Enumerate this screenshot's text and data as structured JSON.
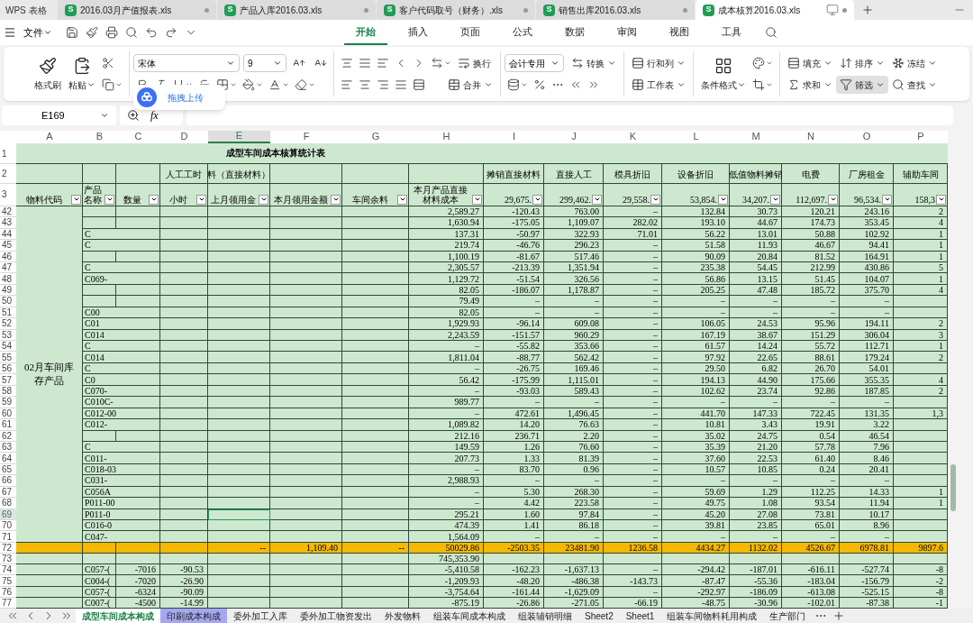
{
  "app_name": "WPS 表格",
  "file_tabs": [
    {
      "icon_letter": "S",
      "title": "2016.03月产值报表.xls",
      "selected": false
    },
    {
      "icon_letter": "S",
      "title": "产品入库2016.03.xls",
      "selected": false
    },
    {
      "icon_letter": "S",
      "title": "客户代码取号（财务）.xls",
      "selected": false
    },
    {
      "icon_letter": "S",
      "title": "销售出库2016.03.xls",
      "selected": false
    },
    {
      "icon_letter": "S",
      "title": "成本核算2016.03.xls",
      "selected": true
    }
  ],
  "file_menu": "文件",
  "ribbon_tabs": [
    {
      "label": "开始",
      "selected": true
    },
    {
      "label": "插入",
      "selected": false
    },
    {
      "label": "页面",
      "selected": false
    },
    {
      "label": "公式",
      "selected": false
    },
    {
      "label": "数据",
      "selected": false
    },
    {
      "label": "审阅",
      "selected": false
    },
    {
      "label": "视图",
      "selected": false
    },
    {
      "label": "工具",
      "selected": false
    }
  ],
  "ribbon": {
    "format_painter": "格式刷",
    "paste": "粘贴",
    "font_name": "宋体",
    "font_size": "9",
    "wrap": "换行",
    "merge": "合并",
    "number_format": "会计专用",
    "convert": "转换",
    "rows_cols": "行和列",
    "worksheet": "工作表",
    "conditional_format": "条件格式",
    "fill": "填充",
    "sort": "排序",
    "freeze": "冻结",
    "sum": "求和",
    "filter": "筛选",
    "filter_active": true,
    "find": "查找"
  },
  "upload_popup": "拖拽上传",
  "formula_bar": {
    "cell_ref": "E169",
    "fx_label": "fx"
  },
  "columns": [
    {
      "letter": "A",
      "selected": false
    },
    {
      "letter": "B",
      "selected": false
    },
    {
      "letter": "C",
      "selected": false
    },
    {
      "letter": "D",
      "selected": false
    },
    {
      "letter": "E",
      "selected": true
    },
    {
      "letter": "F",
      "selected": false
    },
    {
      "letter": "G",
      "selected": false
    },
    {
      "letter": "H",
      "selected": false
    },
    {
      "letter": "I",
      "selected": false
    },
    {
      "letter": "J",
      "selected": false
    },
    {
      "letter": "K",
      "selected": false
    },
    {
      "letter": "L",
      "selected": false
    },
    {
      "letter": "M",
      "selected": false
    },
    {
      "letter": "N",
      "selected": false
    },
    {
      "letter": "O",
      "selected": false
    },
    {
      "letter": "P",
      "selected": false
    }
  ],
  "sheet_title": {
    "row": "1",
    "text": "成型车间成本核算统计表"
  },
  "header_row2": {
    "row": "2",
    "D": "人工工时",
    "E": "料（直接材料）",
    "I": "摊销直接材料",
    "J": "直接人工",
    "K": "模具折旧",
    "L": "设备折旧",
    "M": "低值物料摊销",
    "N": "电费",
    "O": "厂房租金",
    "P": "辅助车间"
  },
  "header_row3": {
    "row": "3",
    "A": "物料代码",
    "B": "产品名称",
    "C": "数量",
    "D": "小时",
    "E": "上月领用金",
    "F": "本月领用金额",
    "G": "车间余料",
    "H": "本月产品直接材料成本",
    "I": "29,675.",
    "J": "299,462.",
    "K": "29,558.",
    "L": "53,854.",
    "M": "34,207.",
    "N": "112,697.",
    "O": "96,534.",
    "P": "158,3"
  },
  "merged_a_cell": "02月车间库存产品",
  "rows": [
    {
      "num": "42",
      "selected": false,
      "cells": {
        "H": "2,589.27",
        "I": "-120.43",
        "J": "763.00",
        "K": "–",
        "L": "132.84",
        "M": "30.73",
        "N": "120.21",
        "O": "243.16",
        "P": "2"
      }
    },
    {
      "num": "43",
      "selected": false,
      "cells": {
        "H": "1,630.94",
        "I": "-175.05",
        "J": "1,109.07",
        "K": "282.02",
        "L": "193.10",
        "M": "44.67",
        "N": "174.73",
        "O": "353.45",
        "P": "4"
      }
    },
    {
      "num": "44",
      "selected": false,
      "cells": {
        "B": "C",
        "H": "137.31",
        "I": "-50.97",
        "J": "322.93",
        "K": "71.01",
        "L": "56.22",
        "M": "13.01",
        "N": "50.88",
        "O": "102.92",
        "P": "1"
      }
    },
    {
      "num": "45",
      "selected": false,
      "cells": {
        "B": "C",
        "H": "219.74",
        "I": "-46.76",
        "J": "296.23",
        "K": "–",
        "L": "51.58",
        "M": "11.93",
        "N": "46.67",
        "O": "94.41",
        "P": "1"
      }
    },
    {
      "num": "46",
      "selected": false,
      "cells": {
        "H": "1,100.19",
        "I": "-81.67",
        "J": "517.46",
        "K": "–",
        "L": "90.09",
        "M": "20.84",
        "N": "81.52",
        "O": "164.91",
        "P": "1"
      }
    },
    {
      "num": "47",
      "selected": false,
      "cells": {
        "B": "C",
        "H": "2,305.57",
        "I": "-213.39",
        "J": "1,351.94",
        "K": "–",
        "L": "235.38",
        "M": "54.45",
        "N": "212.99",
        "O": "430.86",
        "P": "5"
      }
    },
    {
      "num": "48",
      "selected": false,
      "cells": {
        "B": "C069-",
        "H": "1,129.72",
        "I": "-51.54",
        "J": "326.56",
        "K": "–",
        "L": "56.86",
        "M": "13.15",
        "N": "51.45",
        "O": "104.07",
        "P": "1"
      }
    },
    {
      "num": "49",
      "selected": false,
      "cells": {
        "H": "82.05",
        "I": "-186.07",
        "J": "1,178.87",
        "K": "–",
        "L": "205.25",
        "M": "47.48",
        "N": "185.72",
        "O": "375.70",
        "P": "4"
      }
    },
    {
      "num": "50",
      "selected": false,
      "cells": {
        "H": "79.49",
        "I": "–",
        "J": "–",
        "K": "–",
        "L": "–",
        "M": "–",
        "N": "–",
        "O": "–"
      }
    },
    {
      "num": "51",
      "selected": false,
      "cells": {
        "B": "C00",
        "H": "82.05",
        "I": "–",
        "J": "–",
        "K": "–",
        "L": "–",
        "M": "–",
        "N": "–",
        "O": "–"
      }
    },
    {
      "num": "52",
      "selected": false,
      "cells": {
        "B": "C01",
        "H": "1,929.93",
        "I": "-96.14",
        "J": "609.08",
        "K": "–",
        "L": "106.05",
        "M": "24.53",
        "N": "95.96",
        "O": "194.11",
        "P": "2"
      }
    },
    {
      "num": "53",
      "selected": false,
      "cells": {
        "B": "C014",
        "H": "2,243.59",
        "I": "-151.57",
        "J": "960.29",
        "K": "–",
        "L": "167.19",
        "M": "38.67",
        "N": "151.29",
        "O": "306.04",
        "P": "3"
      }
    },
    {
      "num": "54",
      "selected": false,
      "cells": {
        "B": "C",
        "H": "–",
        "I": "-55.82",
        "J": "353.66",
        "K": "–",
        "L": "61.57",
        "M": "14.24",
        "N": "55.72",
        "O": "112.71",
        "P": "1"
      }
    },
    {
      "num": "55",
      "selected": false,
      "cells": {
        "B": "C014",
        "H": "1,811.04",
        "I": "-88.77",
        "J": "562.42",
        "K": "–",
        "L": "97.92",
        "M": "22.65",
        "N": "88.61",
        "O": "179.24",
        "P": "2"
      }
    },
    {
      "num": "56",
      "selected": false,
      "cells": {
        "B": "C",
        "H": "–",
        "I": "-26.75",
        "J": "169.46",
        "K": "–",
        "L": "29.50",
        "M": "6.82",
        "N": "26.70",
        "O": "54.01"
      }
    },
    {
      "num": "57",
      "selected": false,
      "cells": {
        "B": "C0",
        "H": "56.42",
        "I": "-175.99",
        "J": "1,115.01",
        "K": "–",
        "L": "194.13",
        "M": "44.90",
        "N": "175.66",
        "O": "355.35",
        "P": "4"
      }
    },
    {
      "num": "58",
      "selected": false,
      "cells": {
        "B": "C070-",
        "H": "–",
        "I": "-93.03",
        "J": "589.43",
        "K": "–",
        "L": "102.62",
        "M": "23.74",
        "N": "92.86",
        "O": "187.85",
        "P": "2"
      }
    },
    {
      "num": "59",
      "selected": false,
      "cells": {
        "B": "C010C-",
        "H": "989.77",
        "I": "–",
        "J": "–",
        "K": "–",
        "L": "–",
        "M": "–",
        "N": "–",
        "O": "–"
      }
    },
    {
      "num": "60",
      "selected": false,
      "cells": {
        "B": "C012-00",
        "H": "–",
        "I": "472.61",
        "J": "1,496.45",
        "K": "–",
        "L": "441.70",
        "M": "147.33",
        "N": "722.45",
        "O": "131.35",
        "P": "1,3"
      }
    },
    {
      "num": "61",
      "selected": false,
      "cells": {
        "B": "C012-",
        "H": "1,089.82",
        "I": "14.20",
        "J": "76.63",
        "K": "–",
        "L": "10.81",
        "M": "3.43",
        "N": "19.91",
        "O": "3.22"
      }
    },
    {
      "num": "62",
      "selected": false,
      "cells": {
        "H": "212.16",
        "I": "236.71",
        "J": "2.20",
        "K": "–",
        "L": "35.02",
        "M": "24.75",
        "N": "0.54",
        "O": "46.54"
      }
    },
    {
      "num": "63",
      "selected": false,
      "cells": {
        "B": "C",
        "H": "149.59",
        "I": "1.26",
        "J": "76.60",
        "K": "–",
        "L": "35.39",
        "M": "21.20",
        "N": "57.78",
        "O": "7.96"
      }
    },
    {
      "num": "64",
      "selected": false,
      "cells": {
        "B": "C011-",
        "H": "207.73",
        "I": "1.33",
        "J": "81.39",
        "K": "–",
        "L": "37.60",
        "M": "22.53",
        "N": "61.40",
        "O": "8.46"
      }
    },
    {
      "num": "65",
      "selected": false,
      "cells": {
        "B": "C018-03",
        "H": "–",
        "I": "83.70",
        "J": "0.96",
        "K": "–",
        "L": "10.57",
        "M": "10.85",
        "N": "0.24",
        "O": "20.41"
      }
    },
    {
      "num": "66",
      "selected": false,
      "cells": {
        "B": "C031-",
        "H": "2,988.93",
        "I": "–",
        "J": "–",
        "K": "–",
        "L": "–",
        "M": "–",
        "N": "–",
        "O": "–"
      }
    },
    {
      "num": "67",
      "selected": false,
      "cells": {
        "B": "C056A",
        "H": "–",
        "I": "5.30",
        "J": "268.30",
        "K": "–",
        "L": "59.69",
        "M": "1.29",
        "N": "112.25",
        "O": "14.33",
        "P": "1"
      }
    },
    {
      "num": "68",
      "selected": false,
      "cells": {
        "B": "P011-00",
        "H": "–",
        "I": "4.42",
        "J": "223.58",
        "K": "–",
        "L": "49.75",
        "M": "1.08",
        "N": "93.54",
        "O": "11.94",
        "P": "1"
      }
    },
    {
      "num": "69",
      "selected": true,
      "cells": {
        "B": "P011-0",
        "H": "295.21",
        "I": "1.60",
        "J": "97.84",
        "K": "–",
        "L": "45.20",
        "M": "27.08",
        "N": "73.81",
        "O": "10.17"
      }
    },
    {
      "num": "70",
      "selected": false,
      "cells": {
        "B": "C016-0",
        "H": "474.39",
        "I": "1.41",
        "J": "86.18",
        "K": "–",
        "L": "39.81",
        "M": "23.85",
        "N": "65.01",
        "O": "8.96"
      }
    },
    {
      "num": "71",
      "selected": false,
      "cells": {
        "B": "C047-",
        "H": "1,564.09",
        "I": "–",
        "J": "–",
        "K": "–",
        "L": "–",
        "M": "–",
        "N": "–",
        "O": "–"
      }
    }
  ],
  "rows_below": [
    {
      "num": "72",
      "kind": "total",
      "cells": {
        "E": "--",
        "F": "1,109.40",
        "G": "--",
        "H": "50029.86",
        "I": "-2503.35",
        "J": "23481.90",
        "K": "1236.58",
        "L": "4434.27",
        "M": "1132.02",
        "N": "4526.67",
        "O": "6978.81",
        "P": "9897.6"
      }
    },
    {
      "num": "73",
      "kind": "data",
      "cells": {
        "H": "745,353.90"
      }
    },
    {
      "num": "74",
      "kind": "data",
      "cells": {
        "B": "C057-(",
        "C": "-7016",
        "D": "-90.53",
        "H": "-5,410.58",
        "I": "-162.23",
        "J": "-1,637.13",
        "K": "–",
        "L": "-294.42",
        "M": "-187.01",
        "N": "-616.11",
        "O": "-527.74",
        "P": "-8"
      }
    },
    {
      "num": "75",
      "kind": "data",
      "cells": {
        "B": "C004-(",
        "C": "-7020",
        "D": "-26.90",
        "H": "-1,209.93",
        "I": "-48.20",
        "J": "-486.38",
        "K": "-143.73",
        "L": "-87.47",
        "M": "-55.36",
        "N": "-183.04",
        "O": "-156.79",
        "P": "-2"
      }
    },
    {
      "num": "76",
      "kind": "data",
      "cells": {
        "B": "C057-(",
        "C": "-6324",
        "D": "-90.09",
        "H": "-3,754.64",
        "I": "-161.44",
        "J": "-1,629.09",
        "K": "–",
        "L": "-292.97",
        "M": "-186.09",
        "N": "-613.08",
        "O": "-525.15",
        "P": "-8"
      }
    },
    {
      "num": "77",
      "kind": "data",
      "cells": {
        "B": "C007-(",
        "C": "-4500",
        "D": "-14.99",
        "H": "-875.19",
        "I": "-26.86",
        "J": "-271.05",
        "K": "-66.19",
        "L": "-48.75",
        "M": "-30.96",
        "N": "-102.01",
        "O": "-87.38",
        "P": "-1"
      }
    }
  ],
  "sheet_tabs": [
    {
      "label": "成型车间成本构成",
      "selected": true
    },
    {
      "label": "印刷成本构成",
      "selected": false,
      "color": "#a6a6f2"
    },
    {
      "label": "委外加工入库",
      "selected": false
    },
    {
      "label": "委外加工物资发出",
      "selected": false
    },
    {
      "label": "外发物料",
      "selected": false
    },
    {
      "label": "组装车间成本构成",
      "selected": false
    },
    {
      "label": "组装辅销明细",
      "selected": false
    },
    {
      "label": "Sheet2",
      "selected": false
    },
    {
      "label": "Sheet1",
      "selected": false
    },
    {
      "label": "组装车间物料耗用构成",
      "selected": false
    },
    {
      "label": "生产部门",
      "selected": false
    }
  ]
}
